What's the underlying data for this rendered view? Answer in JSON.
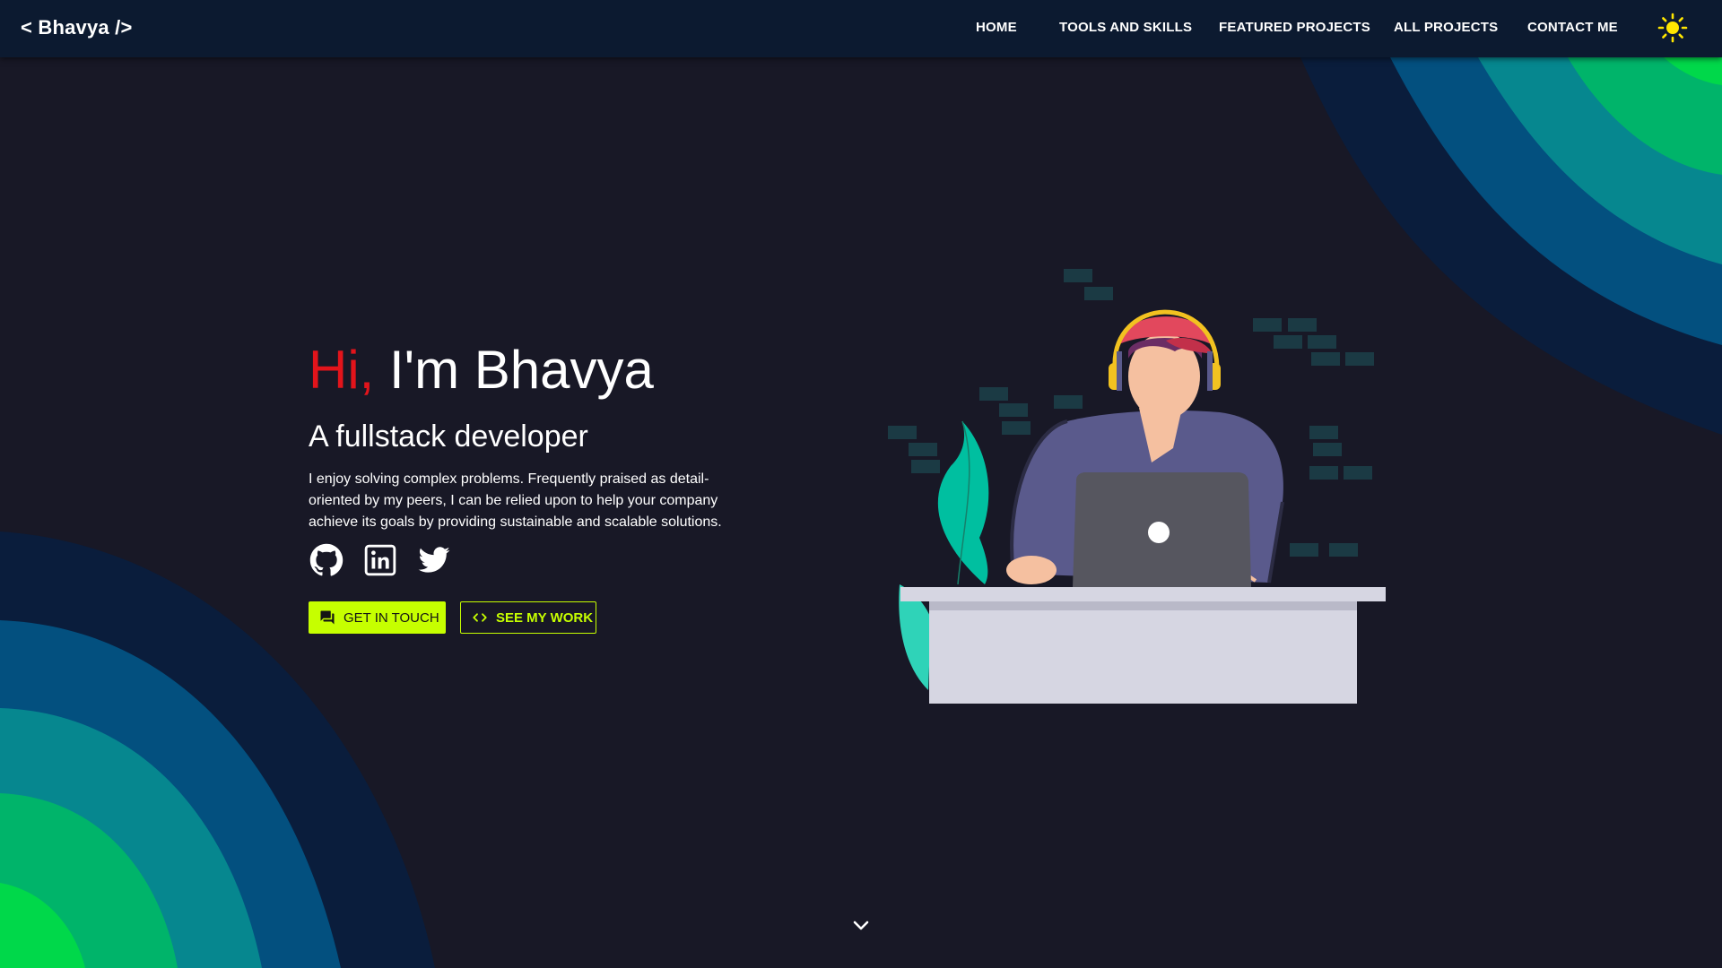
{
  "brand": "< Bhavya />",
  "nav": {
    "items": [
      {
        "label": "HOME"
      },
      {
        "label": "TOOLS AND SKILLS"
      },
      {
        "label": "FEATURED PROJECTS"
      },
      {
        "label": "ALL PROJECTS"
      },
      {
        "label": "CONTACT ME"
      }
    ],
    "theme_icon": "sun-icon"
  },
  "hero": {
    "greeting_hi": "Hi,",
    "greeting_name": "I'm Bhavya",
    "role": "A fullstack developer",
    "bio": "I enjoy solving complex problems. Frequently praised as detail-oriented by my peers, I can be relied upon to help your company achieve its goals by providing sustainable and scalable solutions.",
    "socials": [
      {
        "icon": "github-icon"
      },
      {
        "icon": "linkedin-icon"
      },
      {
        "icon": "twitter-icon"
      }
    ],
    "buttons": {
      "primary": {
        "label": "GET IN TOUCH",
        "icon": "chat-icon"
      },
      "secondary": {
        "label": "SEE MY WORK",
        "icon": "code-icon"
      }
    }
  },
  "scroll_icon": "chevron-down-icon",
  "colors": {
    "background": "#181826",
    "navbar": "#0c1a30",
    "accent": "#c6ff00",
    "hi_red": "#e2141b",
    "sun_yellow": "#ffe600"
  }
}
